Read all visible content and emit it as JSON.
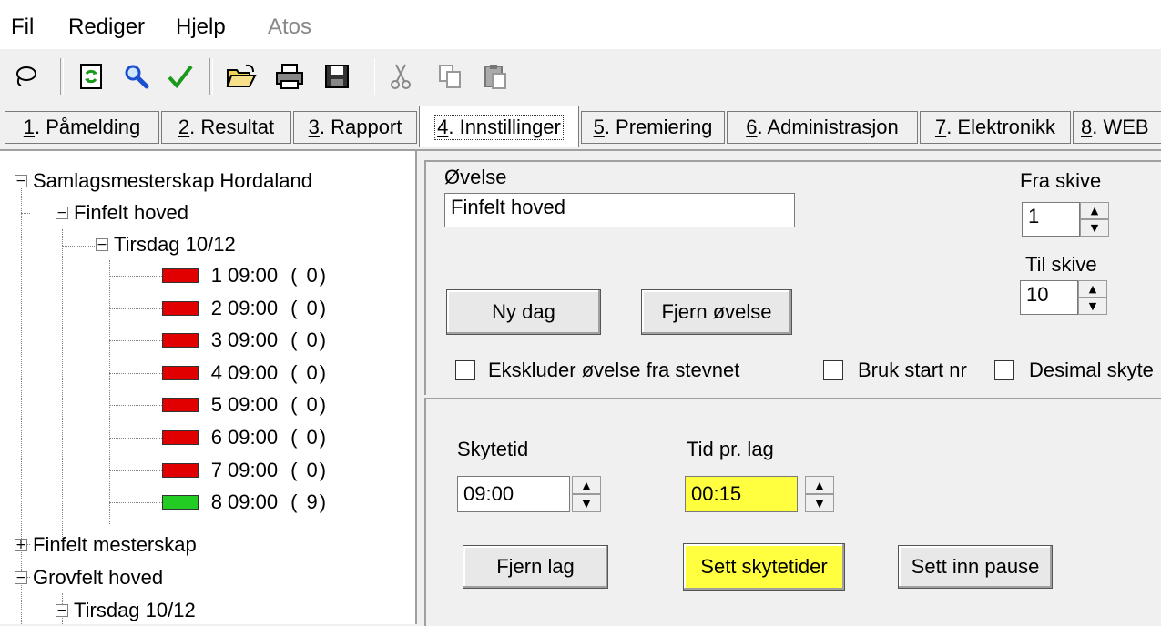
{
  "menu": {
    "items": [
      "Fil",
      "Rediger",
      "Hjelp",
      "Atos"
    ]
  },
  "toolbar": {
    "icons": [
      "lasso-icon",
      "refresh-icon",
      "search-icon",
      "check-icon",
      "open-folder-icon",
      "print-icon",
      "save-icon",
      "cut-icon",
      "copy-icon",
      "paste-icon"
    ]
  },
  "tabs": [
    {
      "num": "1",
      "label": ". Påmelding"
    },
    {
      "num": "2",
      "label": ". Resultat"
    },
    {
      "num": "3",
      "label": ". Rapport"
    },
    {
      "num": "4",
      "label": ". Innstillinger"
    },
    {
      "num": "5",
      "label": ". Premiering"
    },
    {
      "num": "6",
      "label": ". Administrasjon"
    },
    {
      "num": "7",
      "label": ". Elektronikk"
    },
    {
      "num": "8",
      "label": ". WEB"
    }
  ],
  "tree": {
    "root": "Samlagsmesterskap Hordaland",
    "event1": "Finfelt hoved",
    "day1": "Tirsdag 10/12",
    "rounds": [
      {
        "num": "1",
        "time": "09:00",
        "count": "( 0)",
        "status_color": "#e00000"
      },
      {
        "num": "2",
        "time": "09:00",
        "count": "( 0)",
        "status_color": "#e00000"
      },
      {
        "num": "3",
        "time": "09:00",
        "count": "( 0)",
        "status_color": "#e00000"
      },
      {
        "num": "4",
        "time": "09:00",
        "count": "( 0)",
        "status_color": "#e00000"
      },
      {
        "num": "5",
        "time": "09:00",
        "count": "( 0)",
        "status_color": "#e00000"
      },
      {
        "num": "6",
        "time": "09:00",
        "count": "( 0)",
        "status_color": "#e00000"
      },
      {
        "num": "7",
        "time": "09:00",
        "count": "( 0)",
        "status_color": "#e00000"
      },
      {
        "num": "8",
        "time": "09:00",
        "count": "( 9)",
        "status_color": "#22cc22"
      }
    ],
    "event2": "Finfelt mesterskap",
    "event3": "Grovfelt hoved",
    "day3": "Tirsdag 10/12"
  },
  "settings": {
    "ovelse_label": "Øvelse",
    "ovelse_value": "Finfelt hoved",
    "fra_skive_label": "Fra skive",
    "fra_skive_value": "1",
    "til_skive_label": "Til skive",
    "til_skive_value": "10",
    "ny_dag_button": "Ny dag",
    "fjern_ovelse_button": "Fjern øvelse",
    "ekskluder_label": "Ekskluder øvelse fra stevnet",
    "bruk_start_label": "Bruk start nr",
    "desimal_label": "Desimal skyte"
  },
  "schedule": {
    "skytetid_label": "Skytetid",
    "skytetid_value": "09:00",
    "tid_pr_lag_label": "Tid pr. lag",
    "tid_pr_lag_value": "00:15",
    "fjern_lag_button": "Fjern lag",
    "sett_skytetider_button": "Sett skytetider",
    "sett_inn_pause_button": "Sett inn pause",
    "highlight_color": "#ffff40"
  }
}
